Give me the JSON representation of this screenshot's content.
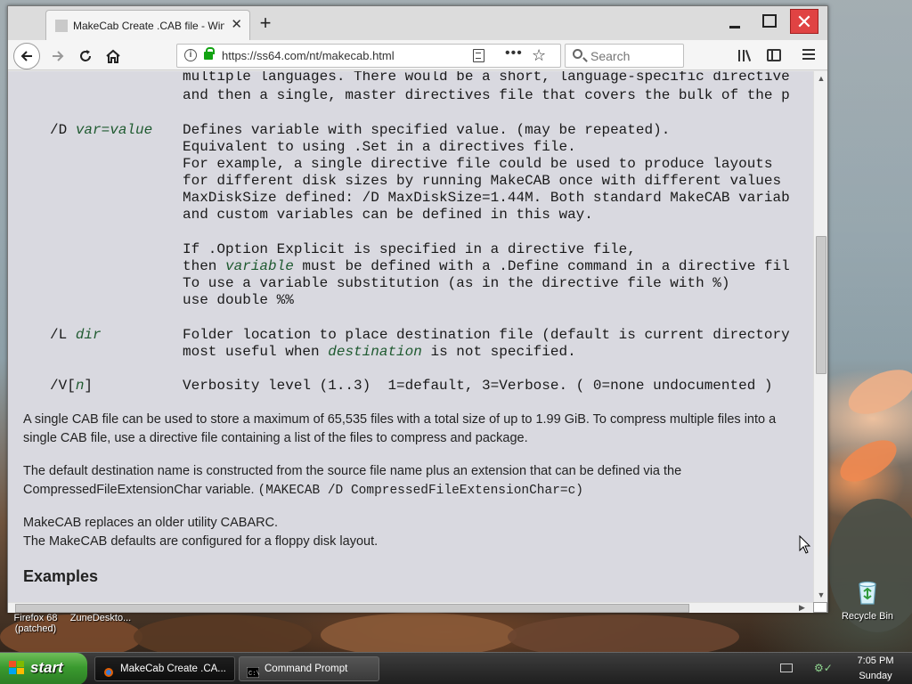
{
  "browser": {
    "tab_title": "MakeCab Create .CAB file - Windo",
    "new_tab_symbol": "+",
    "url": "https://ss64.com/nt/makecab.html",
    "search_placeholder": "Search"
  },
  "content": {
    "top_lines": [
      "multiple languages. There would be a short, language-specific directive",
      "and then a single, master directives file that covers the bulk of the p"
    ],
    "option_d": {
      "switch": "/D",
      "arg": "var=value",
      "lines": [
        "Defines variable with specified value. (may be repeated).",
        "Equivalent to using .Set in a directives file.",
        "For example, a single directive file could be used to produce layouts",
        "for different disk sizes by running MakeCAB once with different values",
        "MaxDiskSize defined: /D MaxDiskSize=1.44M. Both standard MakeCAB variab",
        "and custom variables can be defined in this way."
      ],
      "lines2_a": "If .Option Explicit is specified in a directive file,",
      "lines2_b_pre": "then ",
      "lines2_b_em": "variable",
      "lines2_b_post": " must be defined with a .Define command in a directive fil",
      "lines2_c": "To use a variable substitution (as in the directive file with %)",
      "lines2_d": "use double %%"
    },
    "option_l": {
      "switch": "/L",
      "arg": "dir",
      "line1": "Folder location to place destination file (default is current directory",
      "line2_pre": "most useful when ",
      "line2_em": "destination",
      "line2_post": " is not specified."
    },
    "option_v": {
      "switch_pre": "/V[",
      "switch_em": "n",
      "switch_post": "]",
      "line": "Verbosity level (1..3)  1=default, 3=Verbose. ( 0=none undocumented )"
    },
    "para1": "A single CAB file can be used to store a maximum of 65,535 files with a total size of up to 1.99 GiB. To compress multiple files into a single CAB file, use a directive file containing a list of the files to compress and package.",
    "para2_text": "The default destination name is constructed from the source file name plus an extension that can be defined via the CompressedFileExtensionChar variable. ",
    "para2_code": "(MAKECAB /D CompressedFileExtensionChar=c)",
    "para3_line1": "MakeCAB replaces an older utility CABARC.",
    "para3_line2": "The MakeCAB defaults are configured for a floppy disk layout.",
    "examples_heading": "Examples"
  },
  "desktop": {
    "icons": [
      {
        "label": "Firefox 68 (patched)",
        "icon": "firefox-icon"
      },
      {
        "label": "ZuneDeskto...",
        "icon": "zune-icon"
      },
      {
        "label": "Recycle Bin",
        "icon": "recycle-bin-icon"
      }
    ]
  },
  "taskbar": {
    "start_label": "start",
    "items": [
      {
        "label": "MakeCab Create .CA...",
        "icon": "firefox-icon"
      },
      {
        "label": "Command Prompt",
        "icon": "cmd-icon"
      }
    ],
    "clock_time": "7:05 PM",
    "clock_day": "Sunday"
  },
  "colors": {
    "page_bg": "#d9d9e0",
    "italic_arg": "#1f5a30",
    "start_green": "#3a9a2f",
    "close_red": "#e04343"
  }
}
